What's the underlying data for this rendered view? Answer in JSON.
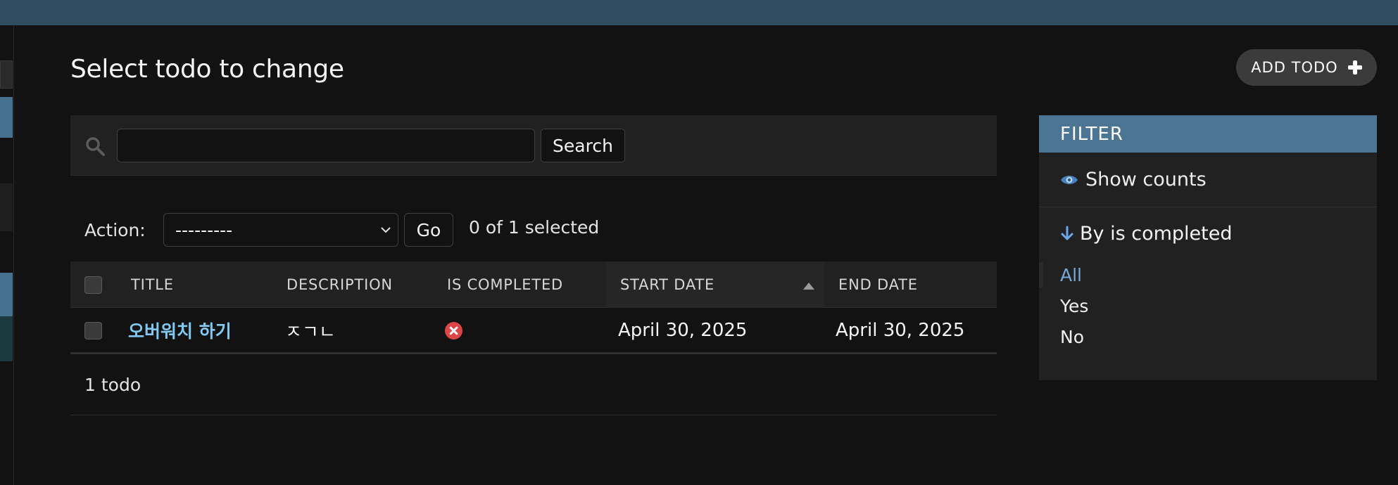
{
  "colors": {
    "topbar": "#2f4e62",
    "background": "#121212",
    "panel": "#212121",
    "filter_header": "#4b7593",
    "link": "#81c8f2",
    "selected_filter": "#79a8d9",
    "status_no": "#dd4646"
  },
  "page": {
    "title": "Select todo to change",
    "add_button_label": "ADD TODO"
  },
  "search": {
    "value": "",
    "button_label": "Search"
  },
  "actions": {
    "label": "Action:",
    "selected_option": "---------",
    "go_label": "Go",
    "selected_count_text": "0 of 1 selected"
  },
  "table": {
    "columns": [
      "TITLE",
      "DESCRIPTION",
      "IS COMPLETED",
      "START DATE",
      "END DATE"
    ],
    "sorted_column": "START DATE",
    "rows": [
      {
        "title": "오버워치 하기",
        "description": "ㅈㄱㄴ",
        "is_completed": false,
        "start_date": "April 30, 2025",
        "end_date": "April 30, 2025"
      }
    ]
  },
  "paginator": {
    "text": "1 todo"
  },
  "filter": {
    "header": "FILTER",
    "show_counts_label": "Show counts",
    "section_title": "By is completed",
    "options": [
      "All",
      "Yes",
      "No"
    ],
    "selected_option": "All"
  },
  "icons": {
    "search": "search-icon",
    "add": "plus-icon",
    "dropdown": "chevron-down-icon",
    "sort": "sort-up-icon",
    "boolean_no": "x-circle-icon",
    "show_counts": "eye-icon",
    "filter_section": "arrow-down-icon"
  }
}
